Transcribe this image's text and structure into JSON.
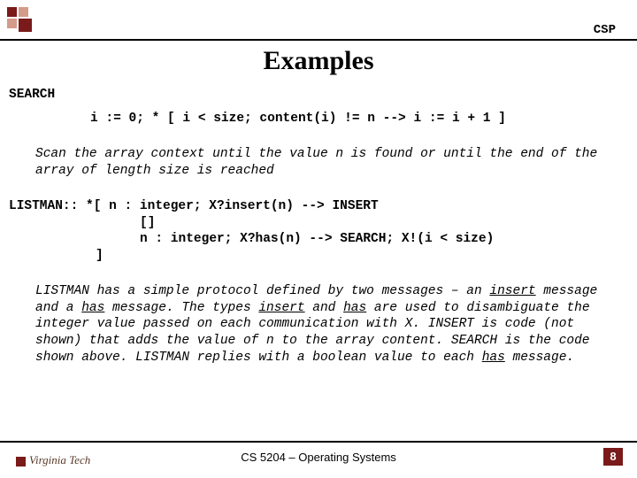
{
  "header": {
    "label": "CSP"
  },
  "title": "Examples",
  "search": {
    "label": "SEARCH",
    "code": "i := 0; * [ i < size; content(i) != n --> i := i + 1 ]",
    "desc": "Scan the array context until the value n is found or until the end of the array of length size is reached"
  },
  "listman": {
    "label": "LISTMAN:: *[ n : integer; X?insert(n) --> INSERT",
    "line2": "[]",
    "line3": "n : integer; X?has(n) --> SEARCH; X!(i < size)",
    "line4": "]",
    "desc_parts": [
      {
        "t": "LISTMAN has a simple protocol defined by two messages – an "
      },
      {
        "t": "insert",
        "u": true
      },
      {
        "t": " message and a "
      },
      {
        "t": "has",
        "u": true
      },
      {
        "t": " message. The types "
      },
      {
        "t": "insert",
        "u": true
      },
      {
        "t": " and "
      },
      {
        "t": "has",
        "u": true
      },
      {
        "t": " are used to disambiguate the integer value passed on each communication with X. INSERT is code (not shown) that adds the value of n to the array content. SEARCH is the code shown above. LISTMAN replies with a boolean value to each "
      },
      {
        "t": "has",
        "u": true
      },
      {
        "t": " message."
      }
    ]
  },
  "footer": {
    "logo": "Virginia Tech",
    "center": "CS 5204 – Operating Systems",
    "page": "8"
  }
}
